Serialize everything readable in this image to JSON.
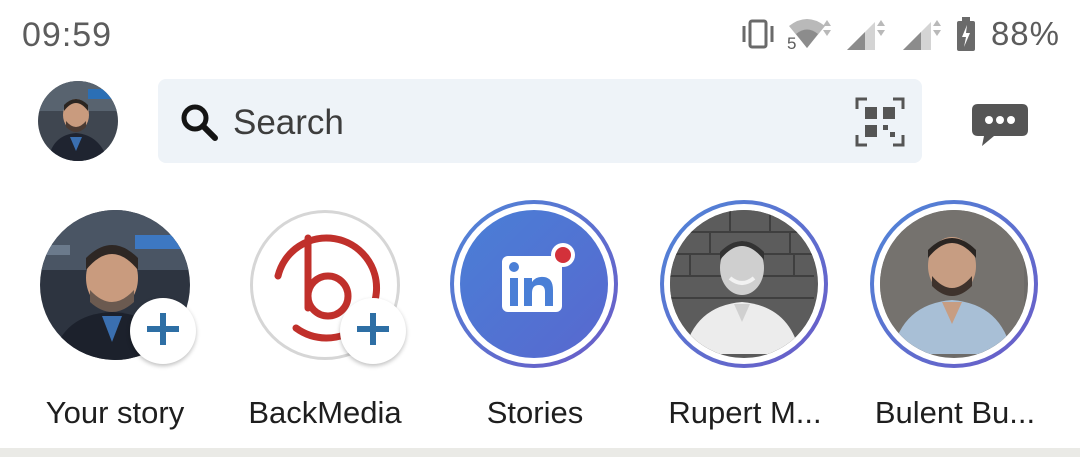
{
  "status_bar": {
    "time": "09:59",
    "battery_percent": "88%",
    "network_label": "5",
    "icons": [
      "vibrate-icon",
      "wifi-icon",
      "signal-icon",
      "signal-icon",
      "battery-icon"
    ]
  },
  "header": {
    "avatar": "profile-avatar",
    "search": {
      "placeholder": "Search"
    },
    "icons": [
      "search-icon",
      "qr-code-icon",
      "messaging-icon"
    ]
  },
  "stories": [
    {
      "label": "Your story",
      "type": "own",
      "badge": "+"
    },
    {
      "label": "BackMedia",
      "type": "company",
      "badge": "+"
    },
    {
      "label": "Stories",
      "type": "linkedin"
    },
    {
      "label": "Rupert M...",
      "type": "person"
    },
    {
      "label": "Bulent Bu...",
      "type": "person"
    }
  ],
  "colors": {
    "linkedin_blue": "#4a7fd6",
    "ring_gradient_start": "#4f86d8",
    "ring_gradient_end": "#6b5bc7",
    "add_badge_plus": "#2e6fa5",
    "backmedia_red": "#c0302b",
    "notification_red": "#d3313a",
    "search_bg": "#eef3f8"
  }
}
